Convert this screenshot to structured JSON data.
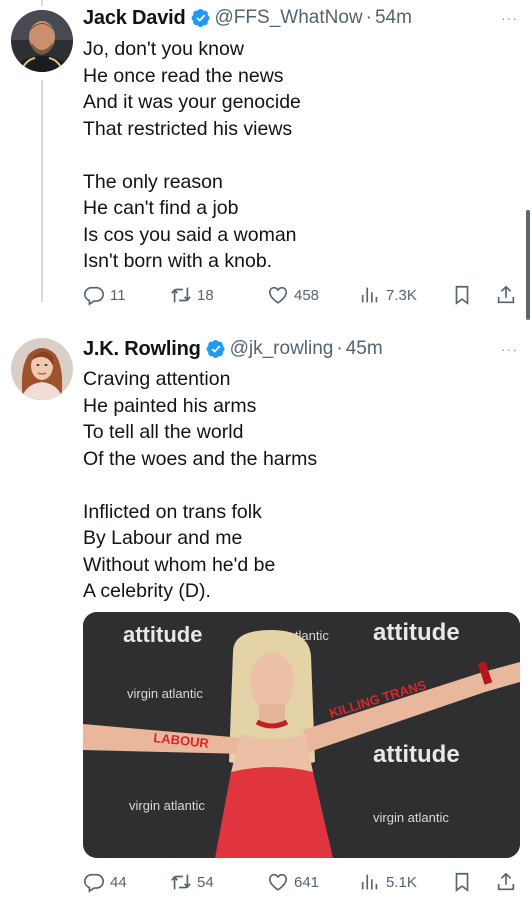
{
  "tweets": [
    {
      "name": "Jack David",
      "handle": "@FFS_WhatNow",
      "separator": "·",
      "time": "54m",
      "more": "···",
      "text": "Jo, don't you know\nHe once read the news\nAnd it was your genocide\nThat restricted his views\n\nThe only reason\nHe can't find a job\nIs cos you said a woman\nIsn't born with a knob.",
      "replies": "11",
      "reposts": "18",
      "likes": "458",
      "views": "7.3K"
    },
    {
      "name": "J.K. Rowling",
      "handle": "@jk_rowling",
      "separator": "·",
      "time": "45m",
      "more": "···",
      "text": "Craving attention\nHe painted his arms\nTo tell all the world\nOf the woes and the harms\n\nInflicted on trans folk\nBy Labour and me\nWithout whom he'd be\nA celebrity (D).",
      "media": {
        "backdrop_brand_1": "attitude",
        "backdrop_brand_2": "virgin atlantic",
        "arm_text_left": "LABOUR",
        "arm_text_right": "KILLING TRANS"
      },
      "replies": "44",
      "reposts": "54",
      "likes": "641",
      "views": "5.1K"
    }
  ],
  "colors": {
    "verified": "#1d9bf0",
    "muted": "#536471",
    "thread_line": "#cfd9de",
    "dress": "#e0353f"
  },
  "icons": [
    "verified-badge-icon",
    "reply-icon",
    "repost-icon",
    "like-icon",
    "views-icon",
    "bookmark-icon",
    "share-icon"
  ]
}
